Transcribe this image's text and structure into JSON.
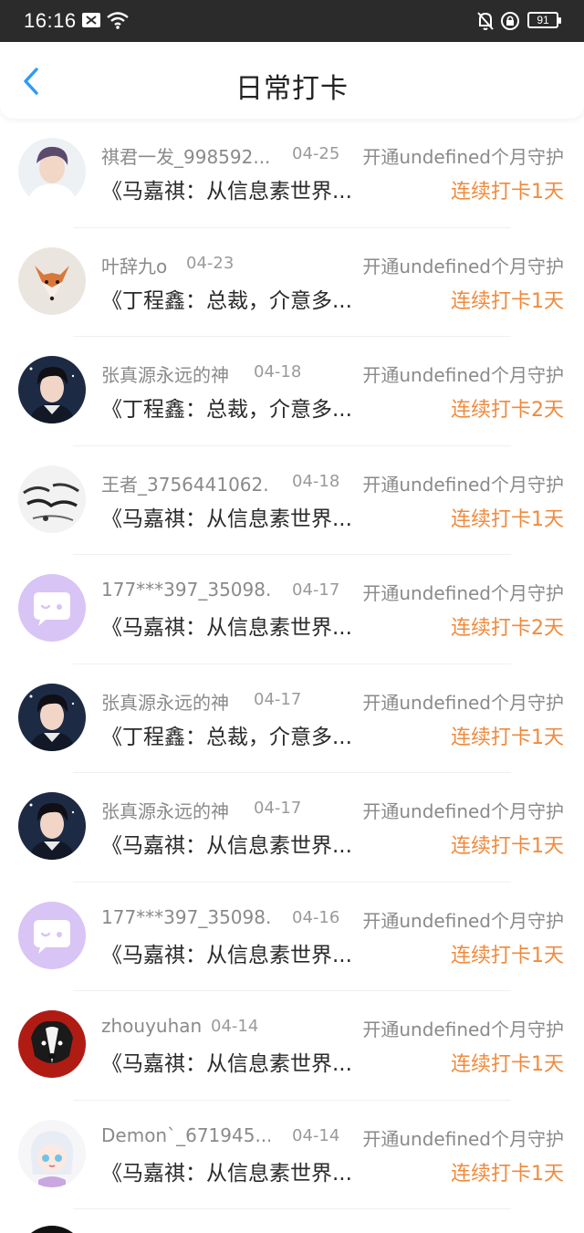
{
  "status_bar": {
    "time": "16:16",
    "battery": "91",
    "icons": [
      "message-icon",
      "wifi-icon",
      "bell-off-icon",
      "lock-icon",
      "battery-icon"
    ]
  },
  "nav": {
    "title": "日常打卡",
    "back_icon": "chevron-left-icon",
    "accent": "#2f9bf4"
  },
  "colors": {
    "streak": "#f08a3c",
    "secondary_text": "#8a8a8a",
    "primary_text": "#2a2a2a"
  },
  "entries": [
    {
      "name": "祺君一发_998592...",
      "date": "04-25",
      "guard": "开通undefined个月守护",
      "post": "《马嘉祺：从信息素世界...",
      "streak": "连续打卡1天",
      "avatar": "boy-white"
    },
    {
      "name": "叶辞九o",
      "date": "04-23",
      "guard": "开通undefined个月守护",
      "post": "《丁程鑫：总裁，介意多...",
      "streak": "连续打卡1天",
      "avatar": "fox"
    },
    {
      "name": "张真源永远的神",
      "date": "04-18",
      "guard": "开通undefined个月守护",
      "post": "《丁程鑫：总裁，介意多...",
      "streak": "连续打卡2天",
      "avatar": "boy-dark"
    },
    {
      "name": "王者_3756441062...",
      "date": "04-18",
      "guard": "开通undefined个月守护",
      "post": "《马嘉祺：从信息素世界...",
      "streak": "连续打卡1天",
      "avatar": "calligraphy"
    },
    {
      "name": "177***397_35098...",
      "date": "04-17",
      "guard": "开通undefined个月守护",
      "post": "《马嘉祺：从信息素世界...",
      "streak": "连续打卡2天",
      "avatar": "default-chat"
    },
    {
      "name": "张真源永远的神",
      "date": "04-17",
      "guard": "开通undefined个月守护",
      "post": "《丁程鑫：总裁，介意多...",
      "streak": "连续打卡1天",
      "avatar": "boy-dark"
    },
    {
      "name": "张真源永远的神",
      "date": "04-17",
      "guard": "开通undefined个月守护",
      "post": "《马嘉祺：从信息素世界...",
      "streak": "连续打卡1天",
      "avatar": "boy-dark"
    },
    {
      "name": "177***397_35098...",
      "date": "04-16",
      "guard": "开通undefined个月守护",
      "post": "《马嘉祺：从信息素世界...",
      "streak": "连续打卡1天",
      "avatar": "default-chat"
    },
    {
      "name": "zhouyuhan",
      "date": "04-14",
      "guard": "开通undefined个月守护",
      "post": "《马嘉祺：从信息素世界...",
      "streak": "连续打卡1天",
      "avatar": "dog"
    },
    {
      "name": "Demon`_671945...",
      "date": "04-14",
      "guard": "开通undefined个月守护",
      "post": "《马嘉祺：从信息素世界...",
      "streak": "连续打卡1天",
      "avatar": "anime"
    }
  ]
}
